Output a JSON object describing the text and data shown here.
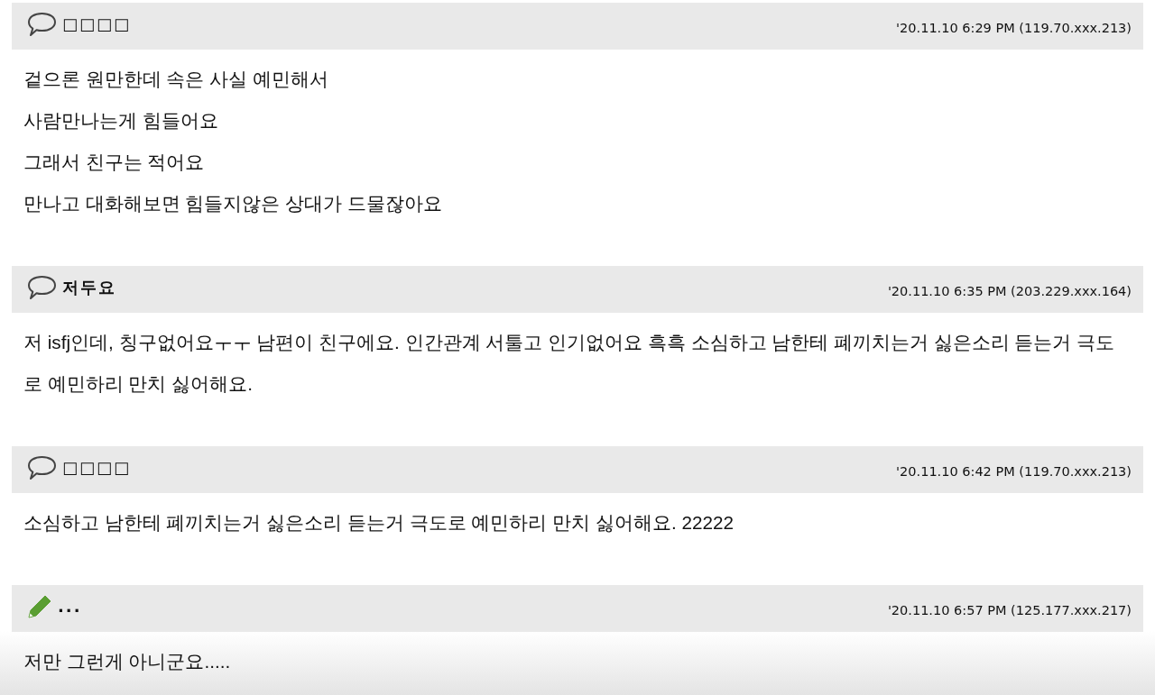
{
  "comments": [
    {
      "kind": "comment",
      "author": "□□□□",
      "timestamp": "'20.11.10 6:29 PM (119.70.xxx.213)",
      "lines": [
        "겉으론 원만한데 속은 사실 예민해서",
        "사람만나는게 힘들어요",
        "그래서 친구는 적어요",
        "만나고 대화해보면 힘들지않은 상대가 드물잖아요"
      ]
    },
    {
      "kind": "comment",
      "author": "저두요",
      "timestamp": "'20.11.10 6:35 PM (203.229.xxx.164)",
      "lines": [
        "저 isfj인데, 칭구없어요ㅜㅜ 남편이 친구에요. 인간관계 서툴고 인기없어요 흑흑 소심하고 남한테 폐끼치는거 싫은소리 듣는거 극도로 예민하리 만치 싫어해요."
      ]
    },
    {
      "kind": "comment",
      "author": "□□□□",
      "timestamp": "'20.11.10 6:42 PM (119.70.xxx.213)",
      "lines": [
        "소심하고 남한테 폐끼치는거 싫은소리 듣는거 극도로 예민하리 만치 싫어해요. 22222"
      ]
    },
    {
      "kind": "edit",
      "author": "...",
      "timestamp": "'20.11.10 6:57 PM (125.177.xxx.217)",
      "lines": [
        "저만 그런게 아니군요....."
      ]
    }
  ]
}
